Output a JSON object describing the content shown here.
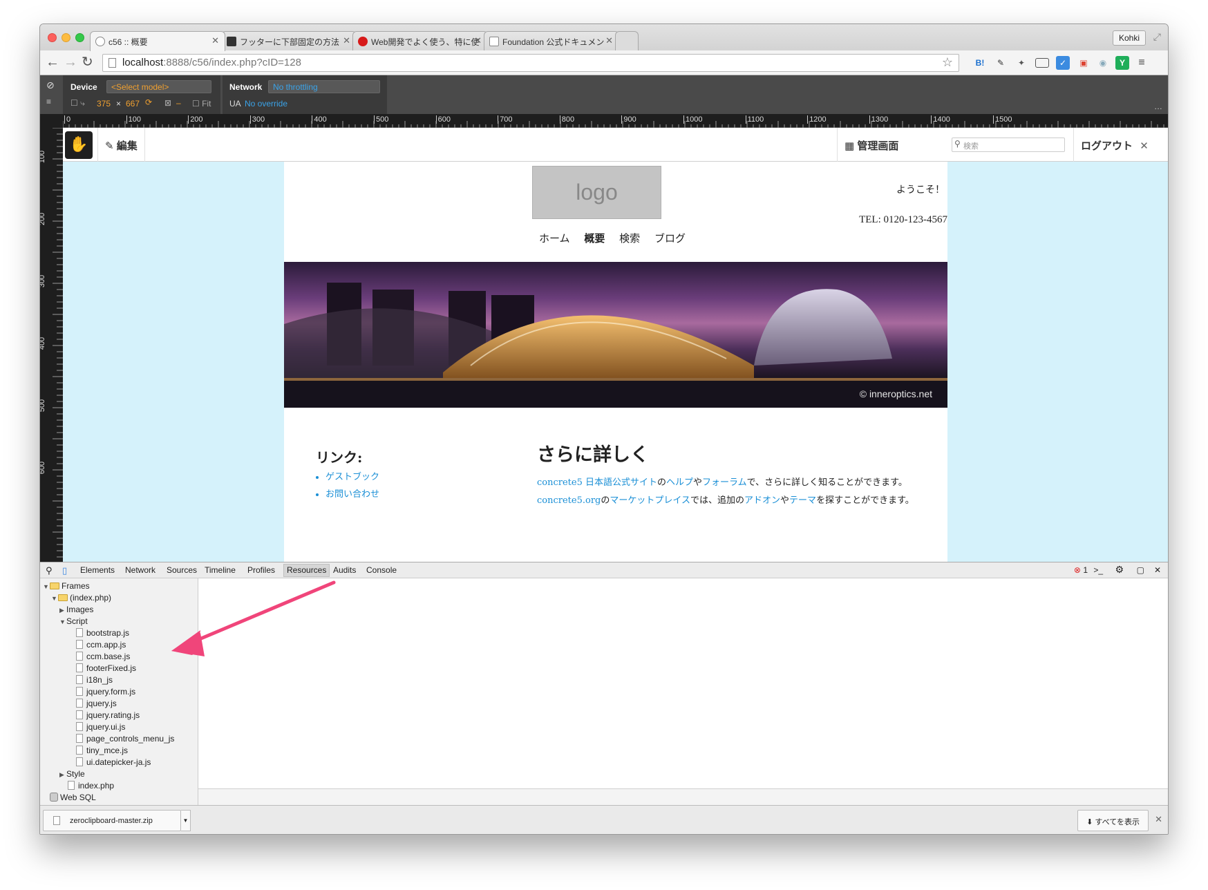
{
  "browser": {
    "tabs": [
      {
        "label": "c56 :: 概要",
        "active": true
      },
      {
        "label": "フッターに下部固定の方法",
        "active": false
      },
      {
        "label": "Web開発でよく使う、特に使",
        "active": false
      },
      {
        "label": "Foundation 公式ドキュメン",
        "active": false
      }
    ],
    "profile": "Kohki",
    "url_host": "localhost",
    "url_path": ":8888/c56/index.php?cID=128"
  },
  "devtools_device": {
    "device_label": "Device",
    "device_select": "<Select model>",
    "network_label": "Network",
    "network_select": "No throttling",
    "width": "375",
    "times": "×",
    "height": "667",
    "fit_label": "Fit",
    "ua_label": "UA",
    "ua_value": "No override",
    "dash": "–"
  },
  "ruler": {
    "h_labels": [
      "0",
      "100",
      "200",
      "300",
      "400",
      "500",
      "600",
      "700",
      "800",
      "900",
      "1000",
      "1100",
      "1200",
      "1300",
      "1400",
      "1500"
    ],
    "v_labels": [
      "100",
      "200",
      "300",
      "400",
      "500",
      "600"
    ]
  },
  "cms": {
    "edit": "編集",
    "dashboard": "管理画面",
    "search_placeholder": "検索",
    "logout": "ログアウト"
  },
  "site": {
    "logo": "logo",
    "welcome": "ようこそ！",
    "tel": "TEL: 0120-123-4567",
    "nav": [
      "ホーム",
      "概要",
      "検索",
      "ブログ"
    ],
    "nav_current": "概要",
    "hero_credit": "© inneroptics.net",
    "links_title": "リンク:",
    "links": [
      "ゲストブック",
      "お問い合わせ"
    ],
    "more_title": "さらに詳しく",
    "more_body": [
      {
        "text": "concrete5 日本語公式サイト",
        "link": true
      },
      {
        "text": "の",
        "link": false
      },
      {
        "text": "ヘルプ",
        "link": true
      },
      {
        "text": "や",
        "link": false
      },
      {
        "text": "フォーラム",
        "link": true
      },
      {
        "text": "で、さらに詳しく知ることができます。",
        "link": false
      },
      {
        "text": "concrete5.org",
        "link": true
      },
      {
        "text": "の",
        "link": false
      },
      {
        "text": "マーケットプレイス",
        "link": true
      },
      {
        "text": "では、追加の",
        "link": false
      },
      {
        "text": "アドオン",
        "link": true
      },
      {
        "text": "や",
        "link": false
      },
      {
        "text": "テーマ",
        "link": true
      },
      {
        "text": "を探すことができます。",
        "link": false
      }
    ]
  },
  "devtools": {
    "tabs": [
      "Elements",
      "Network",
      "Sources",
      "Timeline",
      "Profiles",
      "Resources",
      "Audits",
      "Console"
    ],
    "active_tab": "Resources",
    "error_count": "1",
    "tree": {
      "frames": "Frames",
      "index_frame": "(index.php)",
      "images": "Images",
      "script": "Script",
      "scripts": [
        "bootstrap.js",
        "ccm.app.js",
        "ccm.base.js",
        "footerFixed.js",
        "i18n_js",
        "jquery.form.js",
        "jquery.js",
        "jquery.rating.js",
        "jquery.ui.js",
        "page_controls_menu_js",
        "tiny_mce.js",
        "ui.datepicker-ja.js"
      ],
      "style": "Style",
      "index_file": "index.php",
      "websql": "Web SQL"
    }
  },
  "downloads": {
    "file": "zeroclipboard-master.zip",
    "show_all": "すべてを表示"
  },
  "colors": {
    "accent_orange": "#f0a030",
    "link_blue": "#1a8fd6",
    "viewport_bg": "#d5f2fb",
    "arrow_pink": "#f0457a"
  }
}
